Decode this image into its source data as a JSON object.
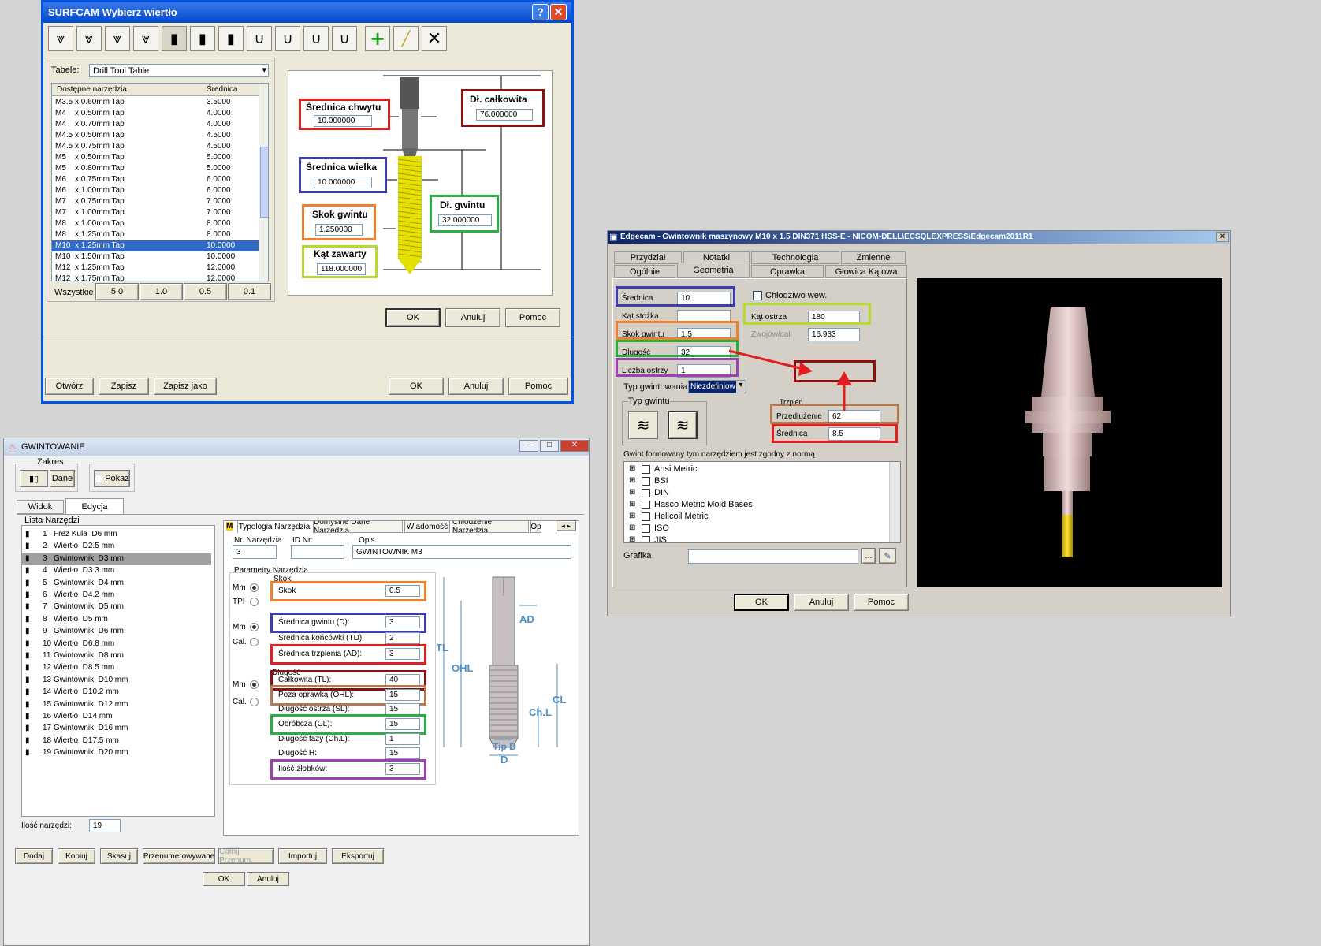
{
  "surfcam": {
    "title": "SURFCAM Wybierz wiertło",
    "table_label": "Tabele:",
    "table_value": "Drill Tool Table",
    "col_tools": "Dostępne narzędzia",
    "col_diam": "Średnica",
    "rows": [
      {
        "name": "M3.5 x 0.60mm Tap",
        "d": "3.5000"
      },
      {
        "name": "M4    x 0.50mm Tap",
        "d": "4.0000"
      },
      {
        "name": "M4    x 0.70mm Tap",
        "d": "4.0000"
      },
      {
        "name": "M4.5 x 0.50mm Tap",
        "d": "4.5000"
      },
      {
        "name": "M4.5 x 0.75mm Tap",
        "d": "4.5000"
      },
      {
        "name": "M5    x 0.50mm Tap",
        "d": "5.0000"
      },
      {
        "name": "M5    x 0.80mm Tap",
        "d": "5.0000"
      },
      {
        "name": "M6    x 0.75mm Tap",
        "d": "6.0000"
      },
      {
        "name": "M6    x 1.00mm Tap",
        "d": "6.0000"
      },
      {
        "name": "M7    x 0.75mm Tap",
        "d": "7.0000"
      },
      {
        "name": "M7    x 1.00mm Tap",
        "d": "7.0000"
      },
      {
        "name": "M8    x 1.00mm Tap",
        "d": "8.0000"
      },
      {
        "name": "M8    x 1.25mm Tap",
        "d": "8.0000"
      },
      {
        "name": "M10  x 1.25mm Tap",
        "d": "10.0000"
      },
      {
        "name": "M10  x 1.50mm Tap",
        "d": "10.0000"
      },
      {
        "name": "M12  x 1.25mm Tap",
        "d": "12.0000"
      },
      {
        "name": "M12  x 1.75mm Tap",
        "d": "12.0000"
      }
    ],
    "filter_all": "Wszystkie",
    "filters": [
      "5.0",
      "1.0",
      "0.5",
      "0.1"
    ],
    "shank_label": "Średnica chwytu",
    "shank_val": "10.000000",
    "total_label": "Dł. całkowita",
    "total_val": "76.000000",
    "size_label": "Średnica wielka",
    "size_val": "10.000000",
    "thread_len_label": "Dł. gwintu",
    "thread_len_val": "32.000000",
    "pitch_label": "Skok gwintu",
    "pitch_val": "1.250000",
    "angle_label": "Kąt zawarty",
    "angle_val": "118.000000",
    "ok": "OK",
    "cancel": "Anuluj",
    "help": "Pomoc",
    "open": "Otwórz",
    "save": "Zapisz",
    "save_as": "Zapisz jako"
  },
  "gw": {
    "title": "GWINTOWANIE",
    "zakres": "Zakres",
    "dane": "Dane",
    "pokaz": "Pokaż",
    "tab_view": "Widok",
    "tab_edit": "Edycja",
    "list_label": "Lista  Narzędzi",
    "tools": [
      {
        "n": "1",
        "t": "Frez Kula  D6 mm"
      },
      {
        "n": "2",
        "t": "Wiertło  D2.5 mm"
      },
      {
        "n": "3",
        "t": "Gwintownik  D3 mm"
      },
      {
        "n": "4",
        "t": "Wiertło  D3.3 mm"
      },
      {
        "n": "5",
        "t": "Gwintownik  D4 mm"
      },
      {
        "n": "6",
        "t": "Wiertło  D4.2 mm"
      },
      {
        "n": "7",
        "t": "Gwintownik  D5 mm"
      },
      {
        "n": "8",
        "t": "Wiertło  D5 mm"
      },
      {
        "n": "9",
        "t": "Gwintownik  D6 mm"
      },
      {
        "n": "10",
        "t": "Wiertło  D6.8 mm"
      },
      {
        "n": "11",
        "t": "Gwintownik  D8 mm"
      },
      {
        "n": "12",
        "t": "Wiertło  D8.5 mm"
      },
      {
        "n": "13",
        "t": "Gwintownik  D10 mm"
      },
      {
        "n": "14",
        "t": "Wiertło  D10.2 mm"
      },
      {
        "n": "15",
        "t": "Gwintownik  D12 mm"
      },
      {
        "n": "16",
        "t": "Wiertło  D14 mm"
      },
      {
        "n": "17",
        "t": "Gwintownik  D16 mm"
      },
      {
        "n": "18",
        "t": "Wiertło  D17.5 mm"
      },
      {
        "n": "19",
        "t": "Gwintownik  D20 mm"
      }
    ],
    "count_label": "Ilość narzędzi:",
    "count_val": "19",
    "tabs": [
      "Typologia Narzędzia",
      "Domyślne Dane Narzędzia",
      "Wiadomość",
      "Chłodzenie Narzędzia",
      "Op"
    ],
    "nr_label": "Nr. Narzędzia",
    "nr_val": "3",
    "id_label": "ID Nr:",
    "id_val": "",
    "opis_label": "Opis",
    "opis_val": "GWINTOWNIK M3",
    "params": "Parametry Narzędzia",
    "skok_group": "Skok",
    "mm": "Mm",
    "tpi": "TPI",
    "cal": "Cal.",
    "skok": "Skok",
    "skok_v": "0.5",
    "sr_gw": "Średnica gwintu (D):",
    "sr_gw_v": "3",
    "sr_konc": "Średnica końcówki (TD):",
    "sr_konc_v": "2",
    "sr_trz": "Średnica trzpienia (AD):",
    "sr_trz_v": "3",
    "dl_group": "Długość",
    "calk": "Całkowita (TL):",
    "calk_v": "40",
    "poza": "Poza oprawką (OHL):",
    "poza_v": "15",
    "dl_ostrza": "Długość ostrza (SL):",
    "dl_ostrza_v": "15",
    "obr": "Obróbcza (CL):",
    "obr_v": "15",
    "fazy": "Długość fazy (Ch.L):",
    "fazy_v": "1",
    "dlh": "Długość H:",
    "dlh_v": "15",
    "zlobki": "Ilość żłobków:",
    "zlobki_v": "3",
    "dim": {
      "tl": "TL",
      "ohl": "OHL",
      "ad": "AD",
      "chl": "Ch.L",
      "cl": "CL",
      "tipd": "Tip D",
      "d": "D"
    },
    "bottom": [
      "Dodaj",
      "Kopiuj",
      "Skasuj",
      "Przenumerowywane",
      "Cofnij Przenum.",
      "Importuj",
      "Eksportuj"
    ],
    "ok": "OK",
    "cancel": "Anuluj"
  },
  "edge": {
    "title": "Edgecam - Gwintownik maszynowy M10 x 1.5 DIN371 HSS-E - NICOM-DELL\\ECSQLEXPRESS\\Edgecam2011R1",
    "tabs_top": [
      "Przydział",
      "Notatki",
      "Technologia",
      "Zmienne"
    ],
    "tabs_bot": [
      "Ogólnie",
      "Geometria",
      "Oprawka",
      "Głowica Kątowa"
    ],
    "sr": "Średnica",
    "sr_v": "10",
    "kat_stozka": "Kąt stożka",
    "kat_stozka_v": "",
    "skok": "Skok gwintu",
    "skok_v": "1.5",
    "dl": "Długość",
    "dl_v": "32",
    "liczba": "Liczba ostrzy",
    "liczba_v": "1",
    "typ": "Typ gwintowania",
    "typ_v": "Niezdefiniow",
    "chlodz": "Chłodziwo wew.",
    "kat_ostrza": "Kąt ostrza",
    "kat_ostrza_v": "180",
    "zwoj": "Zwojów/cal",
    "zwoj_v": "16.933",
    "typ_gw": "Typ gwintu",
    "trzpien": "Trzpień",
    "przedl": "Przedłużenie",
    "przedl_v": "62",
    "sr2": "Średnica",
    "sr2_v": "8.5",
    "norm_label": "Gwint formowany tym narzędziem jest zgodny z normą",
    "norms": [
      "Ansi Metric",
      "BSI",
      "DIN",
      "Hasco Metric Mold Bases",
      "Helicoil Metric",
      "ISO",
      "JIS"
    ],
    "grafika": "Grafika",
    "grafika_v": "",
    "browse": "...",
    "ok": "OK",
    "cancel": "Anuluj",
    "help": "Pomoc"
  },
  "colors": {
    "blue": "#3c3cb4",
    "red": "#e02020",
    "orange": "#f08030",
    "green": "#28b040",
    "lime": "#b4dc28",
    "darkred": "#8c1010",
    "purple": "#a040b4",
    "brown": "#b47850",
    "xp_title": "#0a246a",
    "select": "#316ac5",
    "dim_blue": "#4a90c8"
  }
}
